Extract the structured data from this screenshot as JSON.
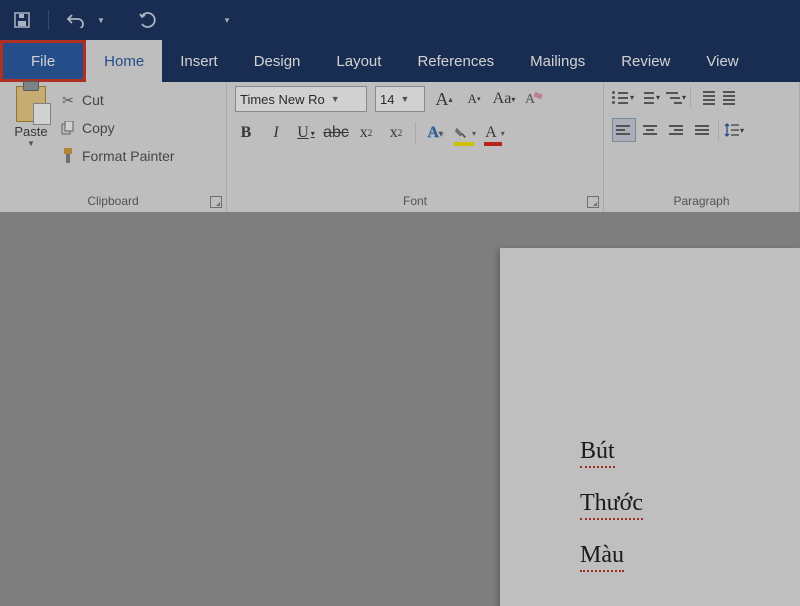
{
  "qat": {
    "save": "save-icon",
    "undo": "undo-icon",
    "redo": "redo-icon"
  },
  "tabs": {
    "file": "File",
    "items": [
      "Home",
      "Insert",
      "Design",
      "Layout",
      "References",
      "Mailings",
      "Review",
      "View"
    ],
    "active": "Home"
  },
  "clipboard": {
    "paste": "Paste",
    "cut": "Cut",
    "copy": "Copy",
    "format_painter": "Format Painter",
    "group_label": "Clipboard"
  },
  "font": {
    "name": "Times New Ro",
    "size": "14",
    "grow": "A",
    "shrink": "A",
    "case": "Aa",
    "clear": "clear-format-icon",
    "bold": "B",
    "italic": "I",
    "underline": "U",
    "strike": "abc",
    "sub": "x",
    "sup": "x",
    "text_effects": "A",
    "highlight": "ab",
    "font_color": "A",
    "group_label": "Font"
  },
  "paragraph": {
    "group_label": "Paragraph"
  },
  "document": {
    "lines": [
      "Bút",
      "Thước",
      "Màu"
    ]
  }
}
